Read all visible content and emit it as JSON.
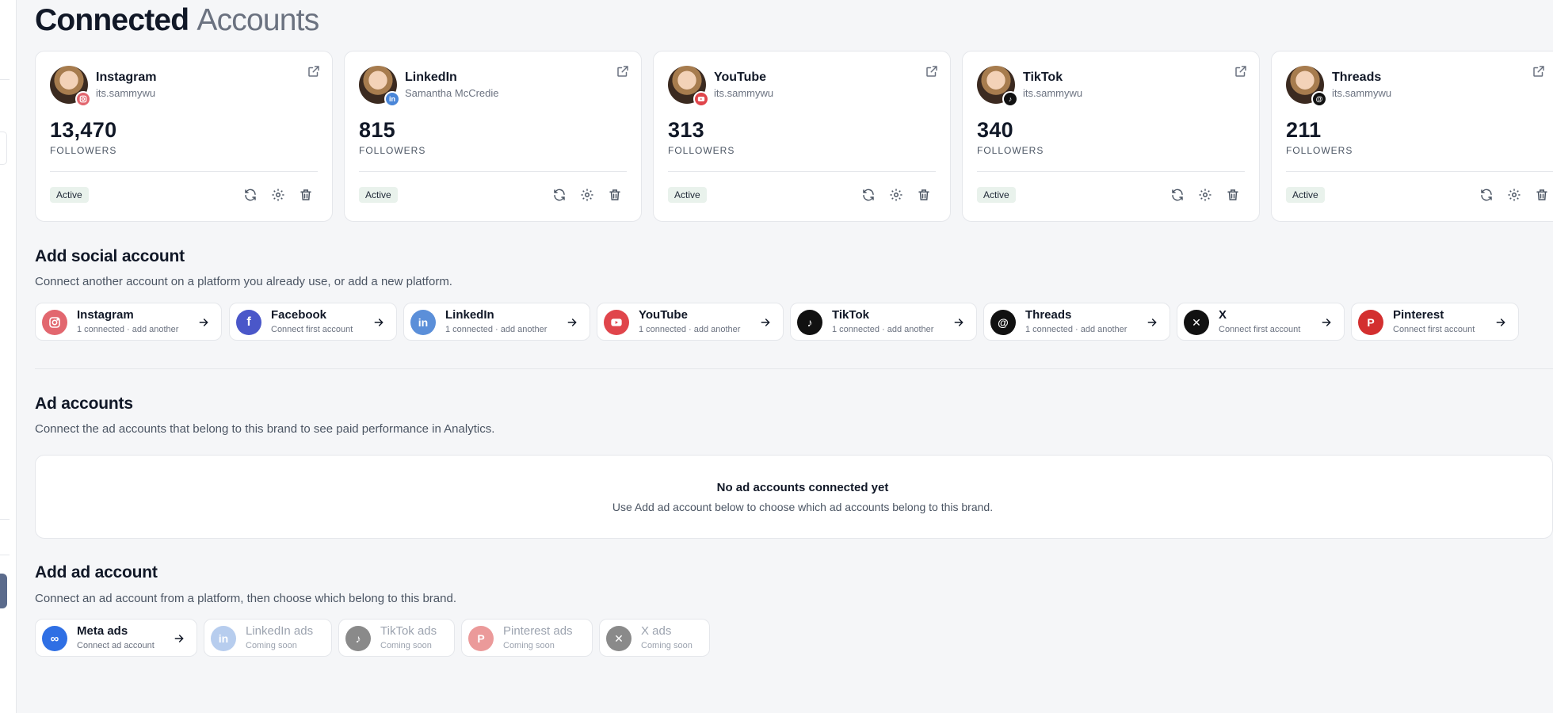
{
  "page": {
    "title_bold": "Connected",
    "title_muted": "Accounts"
  },
  "accounts": [
    {
      "platform": "Instagram",
      "handle": "its.sammywu",
      "followers": "13,470",
      "followers_label": "FOLLOWERS",
      "status": "Active",
      "color": "#e1306c"
    },
    {
      "platform": "LinkedIn",
      "handle": "Samantha McCredie",
      "followers": "815",
      "followers_label": "FOLLOWERS",
      "status": "Active",
      "color": "#4a86d8"
    },
    {
      "platform": "YouTube",
      "handle": "its.sammywu",
      "followers": "313",
      "followers_label": "FOLLOWERS",
      "status": "Active",
      "color": "#e0454b"
    },
    {
      "platform": "TikTok",
      "handle": "its.sammywu",
      "followers": "340",
      "followers_label": "FOLLOWERS",
      "status": "Active",
      "color": "#111111"
    },
    {
      "platform": "Threads",
      "handle": "its.sammywu",
      "followers": "211",
      "followers_label": "FOLLOWERS",
      "status": "Active",
      "color": "#111111"
    }
  ],
  "add_social": {
    "title": "Add social account",
    "subtitle": "Connect another account on a platform you already use, or add a new platform.",
    "items": [
      {
        "name": "Instagram",
        "sub": "1 connected · add another",
        "color": "#e2676f",
        "icon": "instagram-icon"
      },
      {
        "name": "Facebook",
        "sub": "Connect first account",
        "color": "#4a57c9",
        "icon": "facebook-icon"
      },
      {
        "name": "LinkedIn",
        "sub": "1 connected · add another",
        "color": "#5b8fd9",
        "icon": "linkedin-icon"
      },
      {
        "name": "YouTube",
        "sub": "1 connected · add another",
        "color": "#e0454b",
        "icon": "youtube-icon"
      },
      {
        "name": "TikTok",
        "sub": "1 connected · add another",
        "color": "#111111",
        "icon": "tiktok-icon"
      },
      {
        "name": "Threads",
        "sub": "1 connected · add another",
        "color": "#111111",
        "icon": "threads-icon"
      },
      {
        "name": "X",
        "sub": "Connect first account",
        "color": "#111111",
        "icon": "x-icon"
      },
      {
        "name": "Pinterest",
        "sub": "Connect first account",
        "color": "#d32f2f",
        "icon": "pinterest-icon"
      }
    ]
  },
  "ad_accounts": {
    "title": "Ad accounts",
    "subtitle": "Connect the ad accounts that belong to this brand to see paid performance in Analytics.",
    "empty_title": "No ad accounts connected yet",
    "empty_subtitle": "Use Add ad account below to choose which ad accounts belong to this brand."
  },
  "add_ad": {
    "title": "Add ad account",
    "subtitle": "Connect an ad account from a platform, then choose which belong to this brand.",
    "items": [
      {
        "name": "Meta ads",
        "sub": "Connect ad account",
        "color": "#2f6fe4",
        "icon": "meta-icon"
      },
      {
        "name": "LinkedIn ads",
        "sub": "Coming soon",
        "color": "#b7cdee",
        "icon": "linkedin-icon"
      },
      {
        "name": "TikTok ads",
        "sub": "Coming soon",
        "color": "#8a8a8a",
        "icon": "tiktok-icon"
      },
      {
        "name": "Pinterest ads",
        "sub": "Coming soon",
        "color": "#eb9a9a",
        "icon": "pinterest-icon"
      },
      {
        "name": "X ads",
        "sub": "Coming soon",
        "color": "#8a8a8a",
        "icon": "x-icon"
      }
    ]
  }
}
